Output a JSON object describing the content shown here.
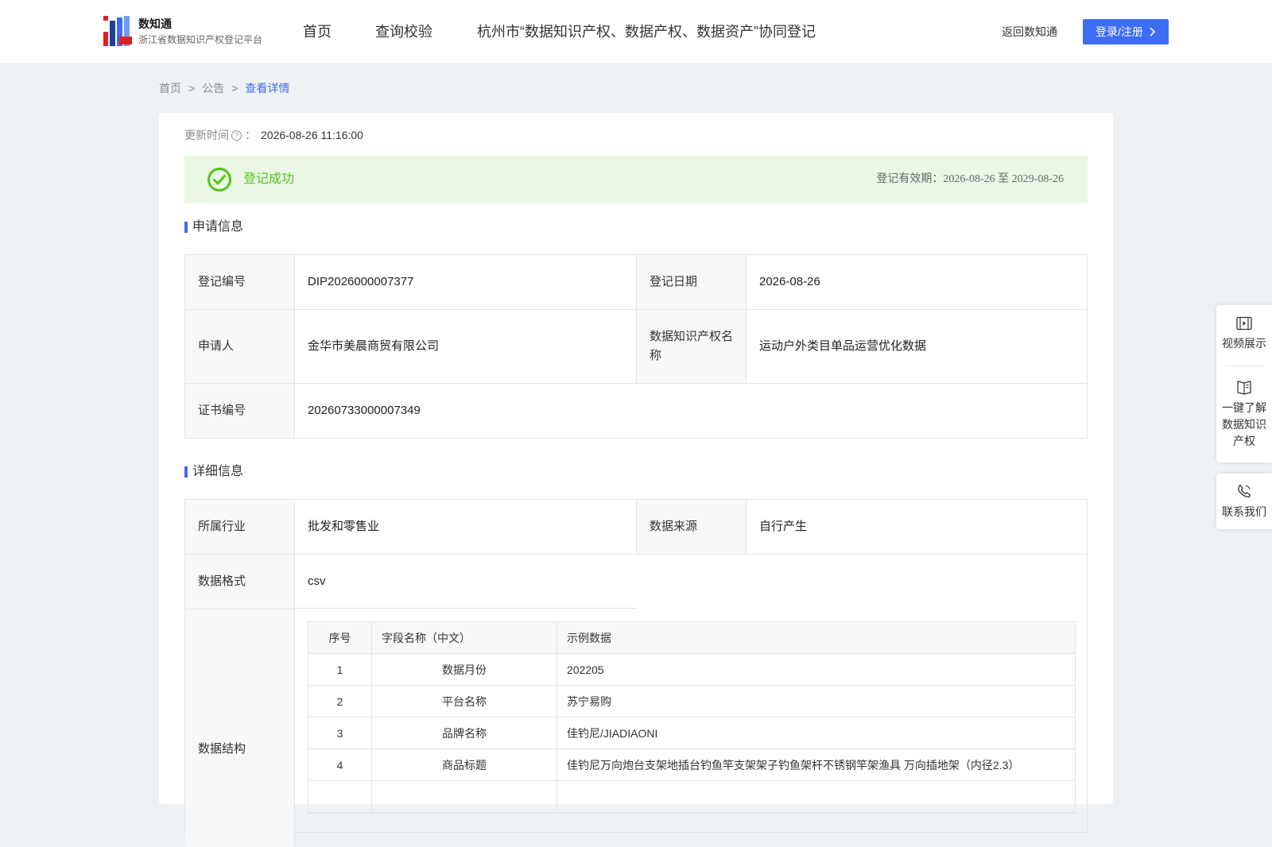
{
  "header": {
    "brand_name": "数知通",
    "brand_sub": "浙江省数据知识产权登记平台",
    "nav": [
      "首页",
      "查询校验",
      "杭州市“数据知识产权、数据产权、数据资产”协同登记"
    ],
    "back_label": "返回数知通",
    "login_label": "登录/注册",
    "accent": "#3d6cf5"
  },
  "breadcrumb": {
    "home": "首页",
    "sep": ">",
    "notice": "公告",
    "current": "查看详情"
  },
  "update": {
    "label": "更新时间",
    "colon": "：",
    "value": "2026-08-26 11:16:00"
  },
  "status": {
    "text": "登记成功",
    "validity": "登记有效期：2026-08-26 至 2029-08-26",
    "color": "#52c41a"
  },
  "apply": {
    "title": "申请信息",
    "reg_no_label": "登记编号",
    "reg_no": "DIP2026000007377",
    "reg_date_label": "登记日期",
    "reg_date": "2026-08-26",
    "applicant_label": "申请人",
    "applicant": "金华市美晨商贸有限公司",
    "ip_name_label": "数据知识产权名称",
    "ip_name": "运动户外类目单品运营优化数据",
    "cert_label": "证书编号",
    "cert_no": "20260733000007349"
  },
  "detail": {
    "title": "详细信息",
    "industry_label": "所属行业",
    "industry": "批发和零售业",
    "source_label": "数据来源",
    "source": "自行产生",
    "format_label": "数据格式",
    "format": "csv",
    "structure_label": "数据结构",
    "table": {
      "headers": [
        "序号",
        "字段名称（中文）",
        "示例数据"
      ],
      "rows": [
        [
          "1",
          "数据月份",
          "202205"
        ],
        [
          "2",
          "平台名称",
          "苏宁易购"
        ],
        [
          "3",
          "品牌名称",
          "佳钓尼/JIADIAONI"
        ],
        [
          "4",
          "商品标题",
          "佳钓尼万向炮台支架地插台钓鱼竿支架架子钓鱼架杆不锈钢竿架渔具 万向插地架（内径2.3）"
        ]
      ]
    }
  },
  "float_panel": {
    "video": "视频展示",
    "learn": [
      "一键了解",
      "数据知识",
      "产权"
    ],
    "contact": "联系我们"
  }
}
